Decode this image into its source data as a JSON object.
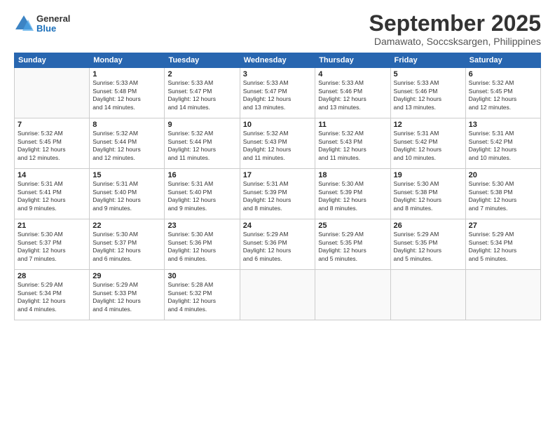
{
  "logo": {
    "general": "General",
    "blue": "Blue"
  },
  "header": {
    "title": "September 2025",
    "subtitle": "Damawato, Soccsksargen, Philippines"
  },
  "weekdays": [
    "Sunday",
    "Monday",
    "Tuesday",
    "Wednesday",
    "Thursday",
    "Friday",
    "Saturday"
  ],
  "weeks": [
    [
      {
        "day": "",
        "info": ""
      },
      {
        "day": "1",
        "info": "Sunrise: 5:33 AM\nSunset: 5:48 PM\nDaylight: 12 hours\nand 14 minutes."
      },
      {
        "day": "2",
        "info": "Sunrise: 5:33 AM\nSunset: 5:47 PM\nDaylight: 12 hours\nand 14 minutes."
      },
      {
        "day": "3",
        "info": "Sunrise: 5:33 AM\nSunset: 5:47 PM\nDaylight: 12 hours\nand 13 minutes."
      },
      {
        "day": "4",
        "info": "Sunrise: 5:33 AM\nSunset: 5:46 PM\nDaylight: 12 hours\nand 13 minutes."
      },
      {
        "day": "5",
        "info": "Sunrise: 5:33 AM\nSunset: 5:46 PM\nDaylight: 12 hours\nand 13 minutes."
      },
      {
        "day": "6",
        "info": "Sunrise: 5:32 AM\nSunset: 5:45 PM\nDaylight: 12 hours\nand 12 minutes."
      }
    ],
    [
      {
        "day": "7",
        "info": "Sunrise: 5:32 AM\nSunset: 5:45 PM\nDaylight: 12 hours\nand 12 minutes."
      },
      {
        "day": "8",
        "info": "Sunrise: 5:32 AM\nSunset: 5:44 PM\nDaylight: 12 hours\nand 12 minutes."
      },
      {
        "day": "9",
        "info": "Sunrise: 5:32 AM\nSunset: 5:44 PM\nDaylight: 12 hours\nand 11 minutes."
      },
      {
        "day": "10",
        "info": "Sunrise: 5:32 AM\nSunset: 5:43 PM\nDaylight: 12 hours\nand 11 minutes."
      },
      {
        "day": "11",
        "info": "Sunrise: 5:32 AM\nSunset: 5:43 PM\nDaylight: 12 hours\nand 11 minutes."
      },
      {
        "day": "12",
        "info": "Sunrise: 5:31 AM\nSunset: 5:42 PM\nDaylight: 12 hours\nand 10 minutes."
      },
      {
        "day": "13",
        "info": "Sunrise: 5:31 AM\nSunset: 5:42 PM\nDaylight: 12 hours\nand 10 minutes."
      }
    ],
    [
      {
        "day": "14",
        "info": "Sunrise: 5:31 AM\nSunset: 5:41 PM\nDaylight: 12 hours\nand 9 minutes."
      },
      {
        "day": "15",
        "info": "Sunrise: 5:31 AM\nSunset: 5:40 PM\nDaylight: 12 hours\nand 9 minutes."
      },
      {
        "day": "16",
        "info": "Sunrise: 5:31 AM\nSunset: 5:40 PM\nDaylight: 12 hours\nand 9 minutes."
      },
      {
        "day": "17",
        "info": "Sunrise: 5:31 AM\nSunset: 5:39 PM\nDaylight: 12 hours\nand 8 minutes."
      },
      {
        "day": "18",
        "info": "Sunrise: 5:30 AM\nSunset: 5:39 PM\nDaylight: 12 hours\nand 8 minutes."
      },
      {
        "day": "19",
        "info": "Sunrise: 5:30 AM\nSunset: 5:38 PM\nDaylight: 12 hours\nand 8 minutes."
      },
      {
        "day": "20",
        "info": "Sunrise: 5:30 AM\nSunset: 5:38 PM\nDaylight: 12 hours\nand 7 minutes."
      }
    ],
    [
      {
        "day": "21",
        "info": "Sunrise: 5:30 AM\nSunset: 5:37 PM\nDaylight: 12 hours\nand 7 minutes."
      },
      {
        "day": "22",
        "info": "Sunrise: 5:30 AM\nSunset: 5:37 PM\nDaylight: 12 hours\nand 6 minutes."
      },
      {
        "day": "23",
        "info": "Sunrise: 5:30 AM\nSunset: 5:36 PM\nDaylight: 12 hours\nand 6 minutes."
      },
      {
        "day": "24",
        "info": "Sunrise: 5:29 AM\nSunset: 5:36 PM\nDaylight: 12 hours\nand 6 minutes."
      },
      {
        "day": "25",
        "info": "Sunrise: 5:29 AM\nSunset: 5:35 PM\nDaylight: 12 hours\nand 5 minutes."
      },
      {
        "day": "26",
        "info": "Sunrise: 5:29 AM\nSunset: 5:35 PM\nDaylight: 12 hours\nand 5 minutes."
      },
      {
        "day": "27",
        "info": "Sunrise: 5:29 AM\nSunset: 5:34 PM\nDaylight: 12 hours\nand 5 minutes."
      }
    ],
    [
      {
        "day": "28",
        "info": "Sunrise: 5:29 AM\nSunset: 5:34 PM\nDaylight: 12 hours\nand 4 minutes."
      },
      {
        "day": "29",
        "info": "Sunrise: 5:29 AM\nSunset: 5:33 PM\nDaylight: 12 hours\nand 4 minutes."
      },
      {
        "day": "30",
        "info": "Sunrise: 5:28 AM\nSunset: 5:32 PM\nDaylight: 12 hours\nand 4 minutes."
      },
      {
        "day": "",
        "info": ""
      },
      {
        "day": "",
        "info": ""
      },
      {
        "day": "",
        "info": ""
      },
      {
        "day": "",
        "info": ""
      }
    ]
  ]
}
